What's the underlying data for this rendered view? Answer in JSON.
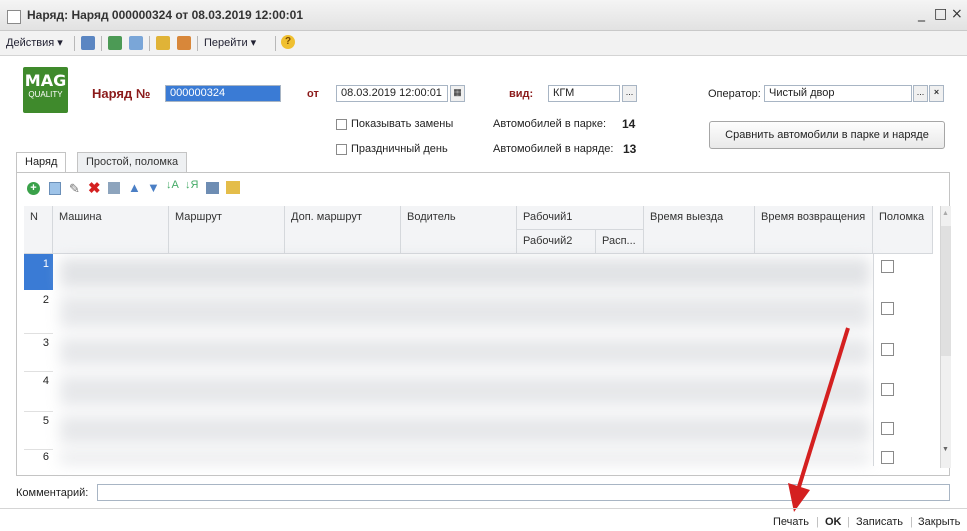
{
  "window": {
    "title": "Наряд: Наряд 000000324 от 08.03.2019 12:00:01",
    "controls": [
      "_",
      "□",
      "×"
    ]
  },
  "toolbar": {
    "actions_label": "Действия ▾",
    "goto_label": "Перейти ▾",
    "help": "?"
  },
  "header": {
    "logo_top": "MAG",
    "logo_bottom": "QUALITY",
    "order_label": "Наряд №",
    "order_number": "000000324",
    "from_label": "от",
    "date_value": "08.03.2019 12:00:01",
    "kind_label": "вид:",
    "kind_value": "КГМ",
    "operator_label": "Оператор:",
    "operator_value": "Чистый двор",
    "show_replacements": "Показывать замены",
    "holiday": "Праздничный день",
    "cars_in_park_label": "Автомобилей в парке:",
    "cars_in_park_value": "14",
    "cars_in_order_label": "Автомобилей в наряде:",
    "cars_in_order_value": "13",
    "compare_button": "Сравнить автомобили в парке и наряде",
    "select_dots": "...",
    "clear_x": "×"
  },
  "tabs": [
    "Наряд",
    "Простой, поломка"
  ],
  "table": {
    "columns": [
      "N",
      "Машина",
      "Маршрут",
      "Доп. маршрут",
      "Водитель",
      "Рабочий1",
      "Время выезда",
      "Время возвращения",
      "Поломка"
    ],
    "sub_columns": [
      "Рабочий2",
      "Расп..."
    ],
    "rows": [
      "1",
      "2",
      "3",
      "4",
      "5",
      "6"
    ]
  },
  "comment_label": "Комментарий:",
  "footer": {
    "print": "Печать",
    "ok": "OK",
    "save": "Записать",
    "close": "Закрыть"
  },
  "colors": {
    "accent_red": "#d42020",
    "logo_green": "#3f8a2c",
    "selection_blue": "#3a7bd5"
  }
}
